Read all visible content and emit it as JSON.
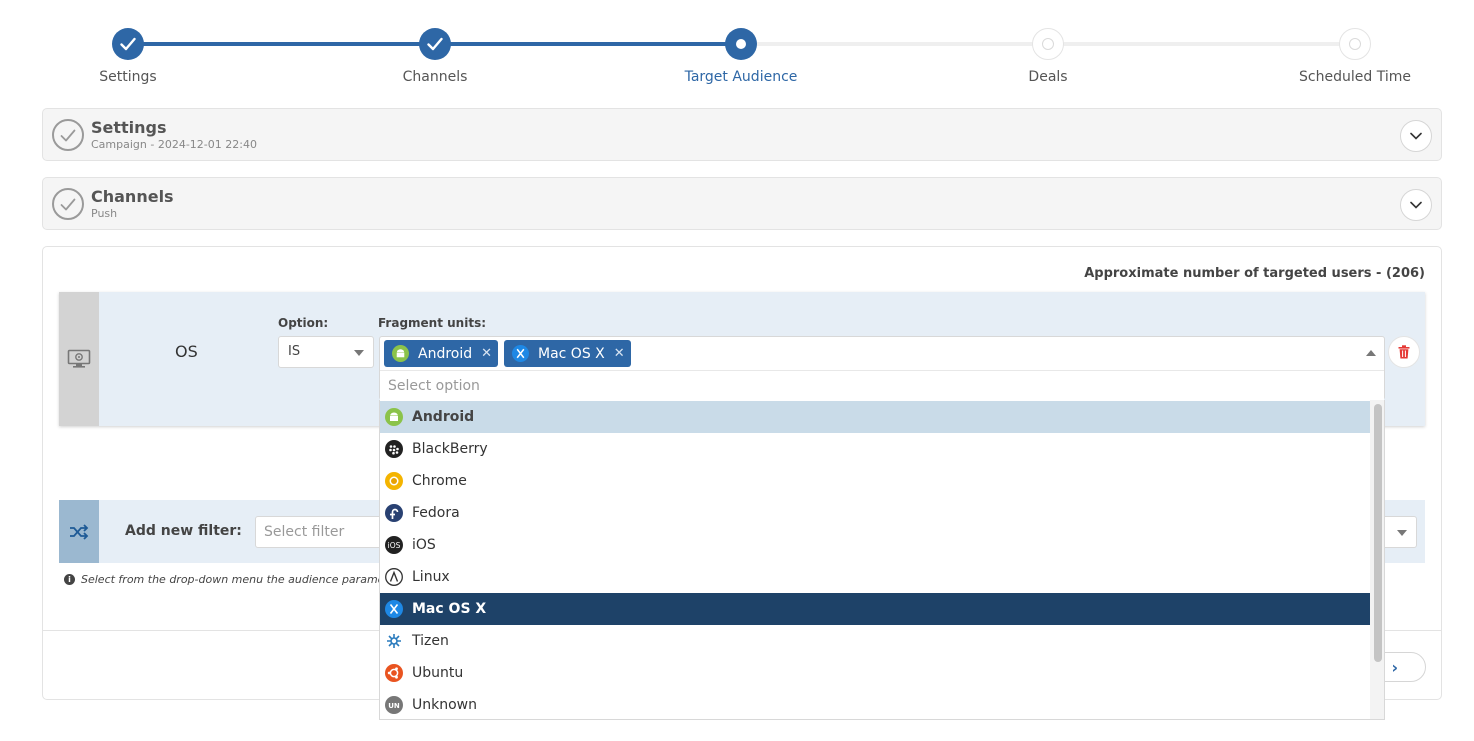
{
  "stepper": {
    "steps": [
      {
        "label": "Settings",
        "state": "done"
      },
      {
        "label": "Channels",
        "state": "done"
      },
      {
        "label": "Target Audience",
        "state": "active"
      },
      {
        "label": "Deals",
        "state": "pending"
      },
      {
        "label": "Scheduled Time",
        "state": "pending"
      }
    ]
  },
  "sections": [
    {
      "title": "Settings",
      "subtitle": "Campaign - 2024-12-01 22:40"
    },
    {
      "title": "Channels",
      "subtitle": "Push"
    }
  ],
  "audience": {
    "approx_label": "Approximate number of targeted users - (206)",
    "filter": {
      "name": "OS",
      "option_label": "Option:",
      "option_value": "IS",
      "fragment_label": "Fragment units:",
      "chips": [
        {
          "label": "Android",
          "icon": "android-icon"
        },
        {
          "label": "Mac OS X",
          "icon": "mac-os-x-icon"
        }
      ],
      "search_placeholder": "Select option"
    },
    "add_filter": {
      "label": "Add new filter:",
      "placeholder": "Select filter"
    },
    "hint": "Select from the drop-down menu the audience parame",
    "next_label": "xt"
  },
  "dropdown": {
    "options": [
      {
        "label": "Android",
        "icon": "android-icon",
        "state": "hover"
      },
      {
        "label": "BlackBerry",
        "icon": "blackberry-icon",
        "state": ""
      },
      {
        "label": "Chrome",
        "icon": "chrome-icon",
        "state": ""
      },
      {
        "label": "Fedora",
        "icon": "fedora-icon",
        "state": ""
      },
      {
        "label": "iOS",
        "icon": "ios-icon",
        "state": ""
      },
      {
        "label": "Linux",
        "icon": "linux-icon",
        "state": ""
      },
      {
        "label": "Mac OS X",
        "icon": "mac-os-x-icon",
        "state": "selected"
      },
      {
        "label": "Tizen",
        "icon": "tizen-icon",
        "state": ""
      },
      {
        "label": "Ubuntu",
        "icon": "ubuntu-icon",
        "state": ""
      },
      {
        "label": "Unknown",
        "icon": "unknown-icon",
        "state": ""
      }
    ]
  },
  "colors": {
    "primary": "#2e67a6",
    "selected": "#1e4268",
    "hover": "#c9dbe8",
    "danger": "#e53935"
  }
}
